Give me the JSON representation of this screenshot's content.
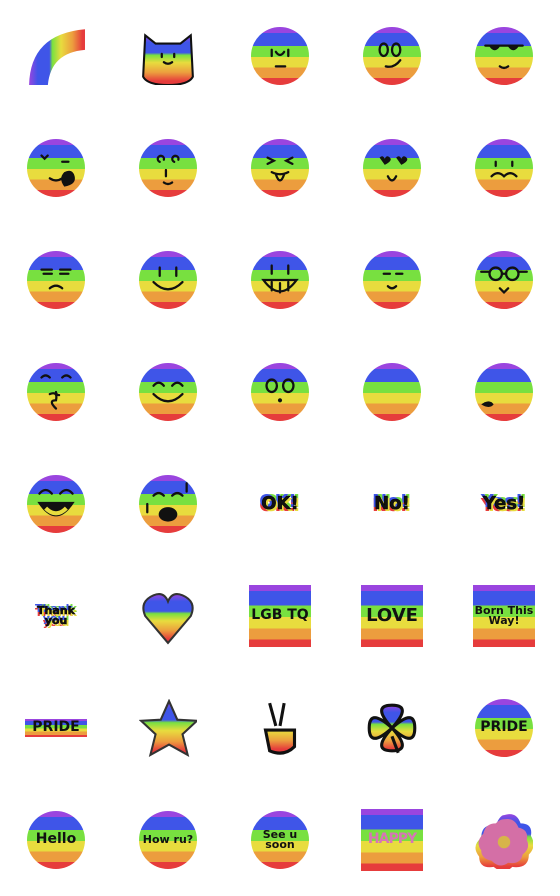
{
  "colors": {
    "purple": "#9a45df",
    "blue": "#3f55e8",
    "green": "#78e040",
    "yellow": "#e8dc3e",
    "orange": "#ec9d3e",
    "red": "#e63c3c",
    "flower_pink": "#d46fa6"
  },
  "stickers": [
    {
      "shape": "arc",
      "icon": "rainbow-arc-icon"
    },
    {
      "shape": "cat",
      "icon": "cat-face-icon"
    },
    {
      "shape": "circle",
      "icon": "face-neutral-u-icon",
      "face": "u"
    },
    {
      "shape": "circle",
      "icon": "face-smirk-icon",
      "face": "smirk"
    },
    {
      "shape": "circle",
      "icon": "face-sunglasses-icon",
      "face": "sunglasses"
    },
    {
      "shape": "circle",
      "icon": "face-love-wink-icon",
      "face": "lovewink"
    },
    {
      "shape": "circle",
      "icon": "face-dizzy-icon",
      "face": "dizzy"
    },
    {
      "shape": "circle",
      "icon": "face-tongue-icon",
      "face": "tongue"
    },
    {
      "shape": "circle",
      "icon": "face-heart-eyes-icon",
      "face": "hearteyes"
    },
    {
      "shape": "circle",
      "icon": "face-mustache-icon",
      "face": "mustache"
    },
    {
      "shape": "circle",
      "icon": "face-frown-icon",
      "face": "frown"
    },
    {
      "shape": "circle",
      "icon": "face-smile-icon",
      "face": "smile"
    },
    {
      "shape": "circle",
      "icon": "face-grin-icon",
      "face": "grin"
    },
    {
      "shape": "circle",
      "icon": "face-content-icon",
      "face": "content"
    },
    {
      "shape": "circle",
      "icon": "face-glasses-icon",
      "face": "glasses"
    },
    {
      "shape": "circle",
      "icon": "face-kiss-icon",
      "face": "kiss"
    },
    {
      "shape": "circle",
      "icon": "face-happy-icon",
      "face": "happy"
    },
    {
      "shape": "circle",
      "icon": "face-surprised-icon",
      "face": "surprised"
    },
    {
      "shape": "circle",
      "icon": "face-blank-icon",
      "face": "blank"
    },
    {
      "shape": "circle",
      "icon": "face-lips-icon",
      "face": "lips"
    },
    {
      "shape": "circle",
      "icon": "face-laugh-icon",
      "face": "laugh"
    },
    {
      "shape": "circle",
      "icon": "face-singing-icon",
      "face": "sing"
    },
    {
      "shape": "text",
      "icon": "ok-sticker-icon",
      "text": "OK!"
    },
    {
      "shape": "text",
      "icon": "no-sticker-icon",
      "text": "No!"
    },
    {
      "shape": "text",
      "icon": "yes-sticker-icon",
      "text": "Yes!"
    },
    {
      "shape": "text",
      "icon": "thank-you-sticker-icon",
      "text": "Thank you"
    },
    {
      "shape": "heart",
      "icon": "rainbow-heart-icon"
    },
    {
      "shape": "square",
      "icon": "lgbtq-sticker-icon",
      "text": "LGB TQ"
    },
    {
      "shape": "square",
      "icon": "love-sticker-icon",
      "text": "LOVE"
    },
    {
      "shape": "square",
      "icon": "born-this-way-sticker-icon",
      "text": "Born This Way!"
    },
    {
      "shape": "pride",
      "icon": "pride-banner-icon",
      "text": "PRIDE"
    },
    {
      "shape": "star",
      "icon": "rainbow-star-icon"
    },
    {
      "shape": "hand",
      "icon": "peace-hand-icon"
    },
    {
      "shape": "clover",
      "icon": "clover-icon"
    },
    {
      "shape": "circle",
      "icon": "pride-circle-sticker-icon",
      "text": "PRIDE"
    },
    {
      "shape": "circle",
      "icon": "hello-sticker-icon",
      "text": "Hello"
    },
    {
      "shape": "circle",
      "icon": "how-r-u-sticker-icon",
      "text": "How ru?"
    },
    {
      "shape": "circle",
      "icon": "see-u-soon-sticker-icon",
      "text": "See u soon"
    },
    {
      "shape": "happy",
      "icon": "happy-sticker-icon",
      "text": "HAPPY"
    },
    {
      "shape": "flower",
      "icon": "flower-icon"
    }
  ]
}
